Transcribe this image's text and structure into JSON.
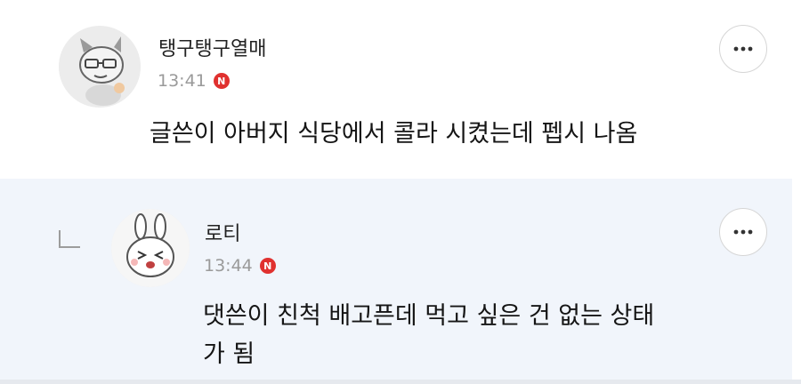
{
  "comments": [
    {
      "nickname": "탱구탱구열매",
      "time": "13:41",
      "badge": "N",
      "text": "글쓴이 아버지 식당에서 콜라 시켰는데 펩시 나옴",
      "avatar_icon": "cat-character-avatar-icon",
      "is_reply": false
    },
    {
      "nickname": "로티",
      "time": "13:44",
      "badge": "N",
      "text_line1": "댓쓴이 친척 배고픈데 먹고 싶은 건 없는 상태",
      "text_line2": "가 됨",
      "avatar_icon": "rabbit-character-avatar-icon",
      "is_reply": true
    }
  ],
  "colors": {
    "badge": "#e0312f",
    "reply_background": "#f1f5fb",
    "time_text": "#9a9a9a"
  }
}
